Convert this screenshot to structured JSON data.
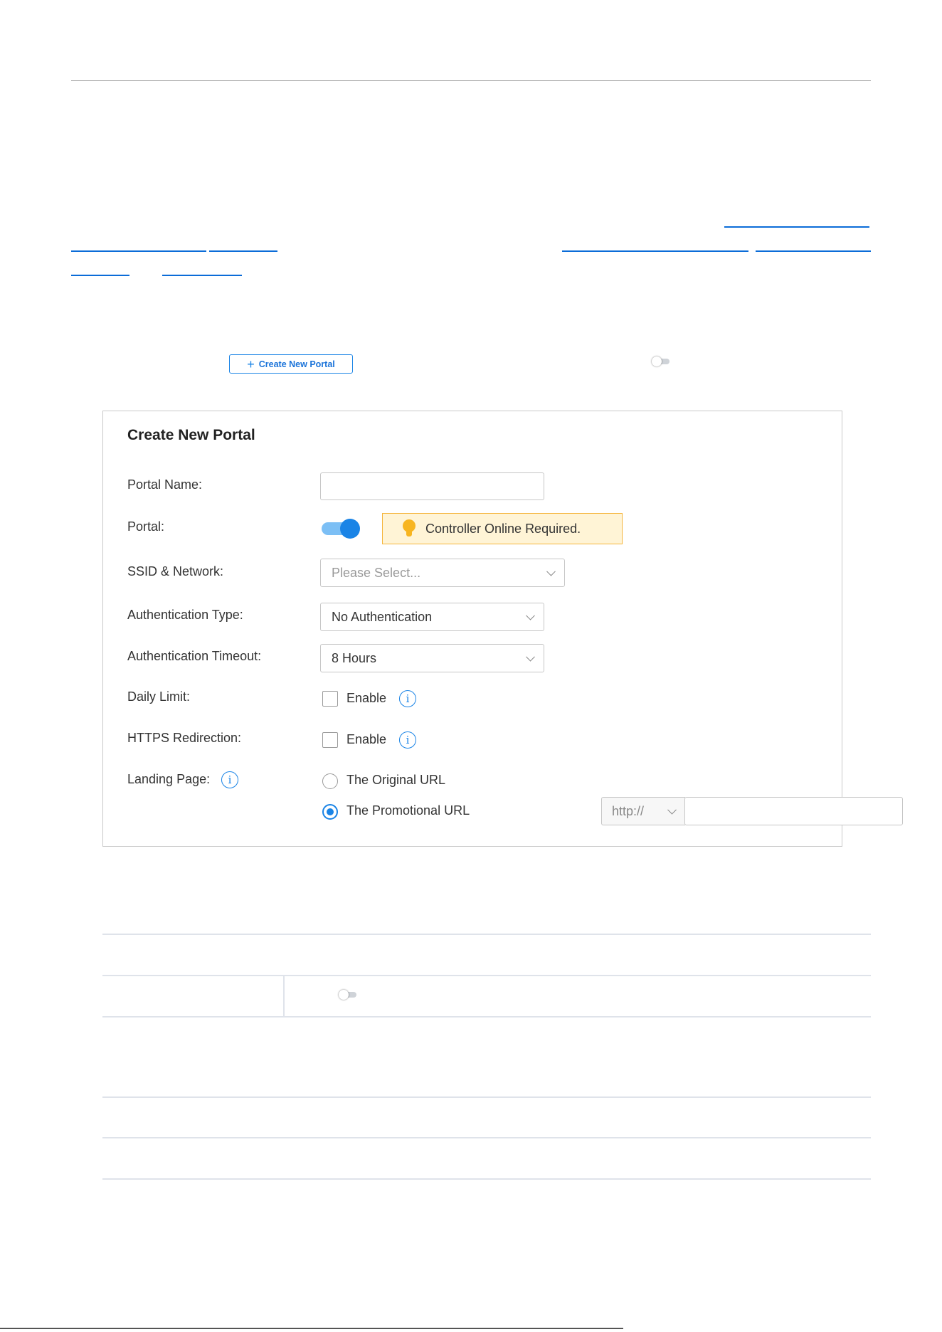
{
  "toolbar": {
    "create_button_label": "Create New Portal",
    "create_button_icon": "plus-icon"
  },
  "panel": {
    "title": "Create New Portal",
    "labels": {
      "portal_name": "Portal Name:",
      "portal": "Portal:",
      "ssid_network": "SSID & Network:",
      "auth_type": "Authentication Type:",
      "auth_timeout": "Authentication Timeout:",
      "daily_limit": "Daily Limit:",
      "https_redirection": "HTTPS Redirection:",
      "landing_page": "Landing Page:"
    },
    "portal_name_value": "",
    "portal_enabled": true,
    "notice_text": "Controller Online Required.",
    "ssid_placeholder": "Please Select...",
    "auth_type_value": "No Authentication",
    "auth_timeout_value": "8 Hours",
    "enable_label": "Enable",
    "daily_limit_checked": false,
    "https_redirection_checked": false,
    "landing_options": {
      "original": "The Original URL",
      "promotional": "The Promotional URL"
    },
    "landing_selected": "promotional",
    "protocol_value": "http://",
    "url_value": ""
  },
  "colors": {
    "accent": "#1a84e6",
    "link": "#0b6cd8",
    "notice_border": "#f5b53c",
    "notice_bg": "#fff4d6"
  }
}
